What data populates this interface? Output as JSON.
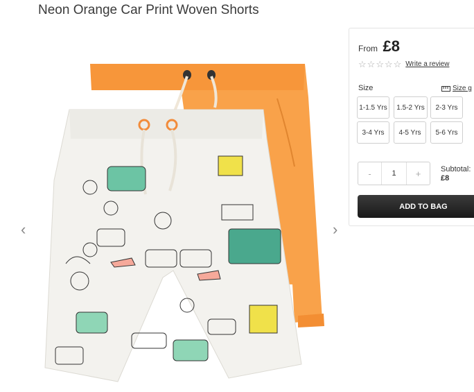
{
  "product": {
    "title": "Neon Orange Car Print Woven Shorts"
  },
  "price": {
    "from_label": "From",
    "value": "£8"
  },
  "rating": {
    "stars_filled": 0,
    "stars_total": 5,
    "review_link": "Write a review"
  },
  "size": {
    "label": "Size",
    "guide_label": "Size g",
    "options": [
      "1-1.5 Yrs",
      "1.5-2 Yrs",
      "2-3 Yrs",
      "3-4 Yrs",
      "4-5 Yrs",
      "5-6 Yrs"
    ]
  },
  "quantity": {
    "minus": "-",
    "value": "1",
    "plus": "+"
  },
  "subtotal": {
    "label": "Subtotal:",
    "amount": "£8"
  },
  "cart": {
    "add_label": "ADD TO BAG"
  },
  "gallery": {
    "prev": "‹",
    "next": "›"
  },
  "colors": {
    "orange_shorts": "#f9a24a",
    "print_shorts_bg": "#f3f2ee",
    "button_dark": "#222222"
  }
}
